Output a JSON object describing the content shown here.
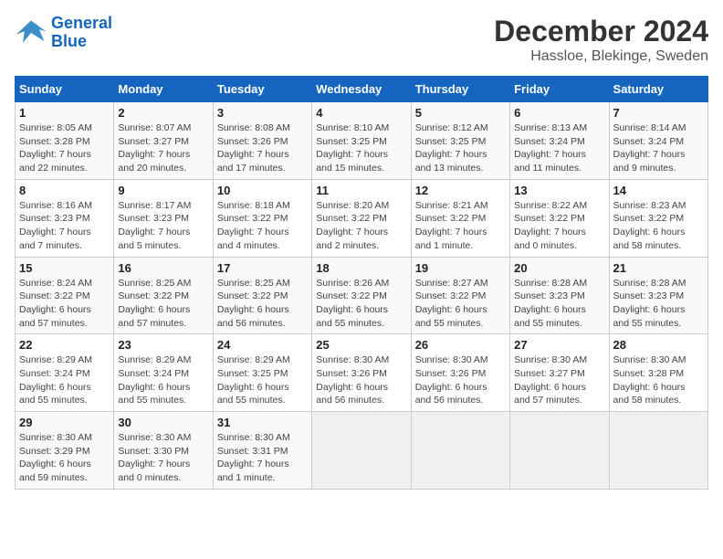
{
  "brand": {
    "line1": "General",
    "line2": "Blue"
  },
  "title": "December 2024",
  "subtitle": "Hassloe, Blekinge, Sweden",
  "days_of_week": [
    "Sunday",
    "Monday",
    "Tuesday",
    "Wednesday",
    "Thursday",
    "Friday",
    "Saturday"
  ],
  "weeks": [
    [
      {
        "day": 1,
        "info": "Sunrise: 8:05 AM\nSunset: 3:28 PM\nDaylight: 7 hours\nand 22 minutes."
      },
      {
        "day": 2,
        "info": "Sunrise: 8:07 AM\nSunset: 3:27 PM\nDaylight: 7 hours\nand 20 minutes."
      },
      {
        "day": 3,
        "info": "Sunrise: 8:08 AM\nSunset: 3:26 PM\nDaylight: 7 hours\nand 17 minutes."
      },
      {
        "day": 4,
        "info": "Sunrise: 8:10 AM\nSunset: 3:25 PM\nDaylight: 7 hours\nand 15 minutes."
      },
      {
        "day": 5,
        "info": "Sunrise: 8:12 AM\nSunset: 3:25 PM\nDaylight: 7 hours\nand 13 minutes."
      },
      {
        "day": 6,
        "info": "Sunrise: 8:13 AM\nSunset: 3:24 PM\nDaylight: 7 hours\nand 11 minutes."
      },
      {
        "day": 7,
        "info": "Sunrise: 8:14 AM\nSunset: 3:24 PM\nDaylight: 7 hours\nand 9 minutes."
      }
    ],
    [
      {
        "day": 8,
        "info": "Sunrise: 8:16 AM\nSunset: 3:23 PM\nDaylight: 7 hours\nand 7 minutes."
      },
      {
        "day": 9,
        "info": "Sunrise: 8:17 AM\nSunset: 3:23 PM\nDaylight: 7 hours\nand 5 minutes."
      },
      {
        "day": 10,
        "info": "Sunrise: 8:18 AM\nSunset: 3:22 PM\nDaylight: 7 hours\nand 4 minutes."
      },
      {
        "day": 11,
        "info": "Sunrise: 8:20 AM\nSunset: 3:22 PM\nDaylight: 7 hours\nand 2 minutes."
      },
      {
        "day": 12,
        "info": "Sunrise: 8:21 AM\nSunset: 3:22 PM\nDaylight: 7 hours\nand 1 minute."
      },
      {
        "day": 13,
        "info": "Sunrise: 8:22 AM\nSunset: 3:22 PM\nDaylight: 7 hours\nand 0 minutes."
      },
      {
        "day": 14,
        "info": "Sunrise: 8:23 AM\nSunset: 3:22 PM\nDaylight: 6 hours\nand 58 minutes."
      }
    ],
    [
      {
        "day": 15,
        "info": "Sunrise: 8:24 AM\nSunset: 3:22 PM\nDaylight: 6 hours\nand 57 minutes."
      },
      {
        "day": 16,
        "info": "Sunrise: 8:25 AM\nSunset: 3:22 PM\nDaylight: 6 hours\nand 57 minutes."
      },
      {
        "day": 17,
        "info": "Sunrise: 8:25 AM\nSunset: 3:22 PM\nDaylight: 6 hours\nand 56 minutes."
      },
      {
        "day": 18,
        "info": "Sunrise: 8:26 AM\nSunset: 3:22 PM\nDaylight: 6 hours\nand 55 minutes."
      },
      {
        "day": 19,
        "info": "Sunrise: 8:27 AM\nSunset: 3:22 PM\nDaylight: 6 hours\nand 55 minutes."
      },
      {
        "day": 20,
        "info": "Sunrise: 8:28 AM\nSunset: 3:23 PM\nDaylight: 6 hours\nand 55 minutes."
      },
      {
        "day": 21,
        "info": "Sunrise: 8:28 AM\nSunset: 3:23 PM\nDaylight: 6 hours\nand 55 minutes."
      }
    ],
    [
      {
        "day": 22,
        "info": "Sunrise: 8:29 AM\nSunset: 3:24 PM\nDaylight: 6 hours\nand 55 minutes."
      },
      {
        "day": 23,
        "info": "Sunrise: 8:29 AM\nSunset: 3:24 PM\nDaylight: 6 hours\nand 55 minutes."
      },
      {
        "day": 24,
        "info": "Sunrise: 8:29 AM\nSunset: 3:25 PM\nDaylight: 6 hours\nand 55 minutes."
      },
      {
        "day": 25,
        "info": "Sunrise: 8:30 AM\nSunset: 3:26 PM\nDaylight: 6 hours\nand 56 minutes."
      },
      {
        "day": 26,
        "info": "Sunrise: 8:30 AM\nSunset: 3:26 PM\nDaylight: 6 hours\nand 56 minutes."
      },
      {
        "day": 27,
        "info": "Sunrise: 8:30 AM\nSunset: 3:27 PM\nDaylight: 6 hours\nand 57 minutes."
      },
      {
        "day": 28,
        "info": "Sunrise: 8:30 AM\nSunset: 3:28 PM\nDaylight: 6 hours\nand 58 minutes."
      }
    ],
    [
      {
        "day": 29,
        "info": "Sunrise: 8:30 AM\nSunset: 3:29 PM\nDaylight: 6 hours\nand 59 minutes."
      },
      {
        "day": 30,
        "info": "Sunrise: 8:30 AM\nSunset: 3:30 PM\nDaylight: 7 hours\nand 0 minutes."
      },
      {
        "day": 31,
        "info": "Sunrise: 8:30 AM\nSunset: 3:31 PM\nDaylight: 7 hours\nand 1 minute."
      },
      null,
      null,
      null,
      null
    ]
  ]
}
